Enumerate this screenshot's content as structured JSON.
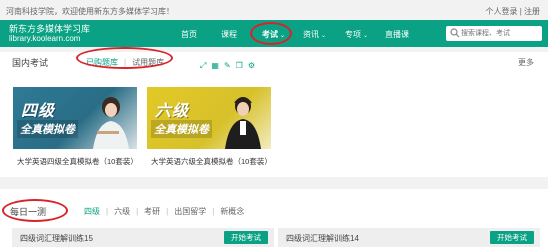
{
  "topbar": {
    "welcome": "河南科技学院，欢迎使用新东方多媒体学习库！",
    "links": "个人登录 | 注册"
  },
  "brand": {
    "name": "新东方多媒体学习库",
    "domain": "library.koolearn.com"
  },
  "nav": {
    "items": [
      {
        "label": "首页"
      },
      {
        "label": "课程"
      },
      {
        "label": "考试"
      },
      {
        "label": "资讯"
      },
      {
        "label": "专项"
      },
      {
        "label": "直播课"
      }
    ],
    "active_index": 2
  },
  "search": {
    "placeholder": "搜索课程、考试",
    "icon": "search-icon"
  },
  "domestic": {
    "title": "国内考试",
    "tabs": [
      "已购题库",
      "试用题库"
    ],
    "active_tab": 0,
    "more": "更多",
    "hover_icons": [
      "expand-icon",
      "grid-icon",
      "edit-icon",
      "copy-icon",
      "settings-icon"
    ],
    "cards": [
      {
        "cover_big": "四级",
        "cover_sub": "全真模拟卷",
        "title": "大学英语四级全真模拟卷（10套装）",
        "color": "#2a6d86"
      },
      {
        "cover_big": "六级",
        "cover_sub": "全真模拟卷",
        "title": "大学英语六级全真模拟卷（10套装）",
        "color": "#d7c12a"
      }
    ]
  },
  "daily": {
    "title": "每日一测",
    "tabs": [
      "四级",
      "六级",
      "考研",
      "出国留学",
      "新概念"
    ],
    "active_tab": 0,
    "rows": [
      {
        "label": "四级词汇理解训练15",
        "button": "开始考试"
      },
      {
        "label": "四级词汇理解训练14",
        "button": "开始考试"
      }
    ]
  },
  "colors": {
    "accent": "#0aa184",
    "highlight_circle": "#d9232b"
  }
}
